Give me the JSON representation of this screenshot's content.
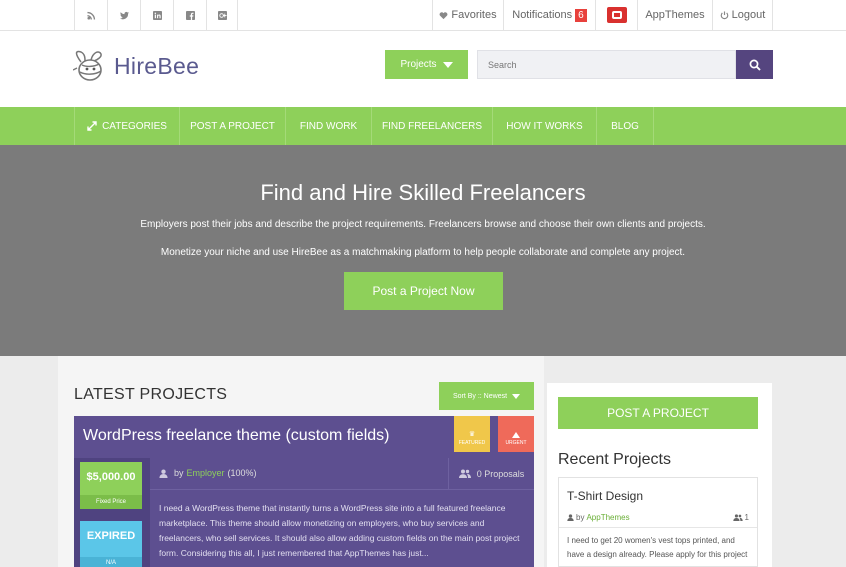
{
  "topbar": {
    "social_icons": [
      "rss-icon",
      "twitter-icon",
      "linkedin-icon",
      "facebook-icon",
      "google-plus-icon"
    ],
    "favorites_label": "Favorites",
    "notifications_label": "Notifications",
    "notifications_count": "6",
    "appthemes_label": "AppThemes",
    "logout_label": "Logout"
  },
  "header": {
    "logo_text": "HireBee",
    "projects_label": "Projects",
    "search_placeholder": "Search"
  },
  "nav": {
    "items": [
      "CATEGORIES",
      "POST A PROJECT",
      "FIND WORK",
      "FIND FREELANCERS",
      "HOW IT WORKS",
      "BLOG"
    ]
  },
  "hero": {
    "title": "Find and Hire Skilled Freelancers",
    "line1": "Employers post their jobs and describe the project requirements. Freelancers browse and choose their own clients and projects.",
    "line2": "Monetize your niche and use HireBee as a matchmaking platform to help people collaborate and complete any project.",
    "cta": "Post a Project Now"
  },
  "latest": {
    "title": "LATEST PROJECTS",
    "sort_label": "Sort By :: Newest",
    "project": {
      "title": "WordPress freelance theme (custom fields)",
      "featured_label": "FEATURED",
      "urgent_label": "URGENT",
      "price": "$5,000.00",
      "price_type": "Fixed Price",
      "status": "EXPIRED",
      "status_sub": "N/A",
      "by_prefix": "by",
      "author": "Employer",
      "rating": "(100%)",
      "proposals": "0 Proposals",
      "description": "I need a WordPress theme that instantly turns a WordPress site into a full featured freelance marketplace. This theme should allow monetizing on employers, who buy services and freelancers, who sell services. It should also allow adding custom fields on the main post project form. Considering this all, I just remembered that AppThemes has just..."
    }
  },
  "sidebar": {
    "post_button": "POST A PROJECT",
    "recent_title": "Recent Projects",
    "recent": {
      "title": "T-Shirt Design",
      "by_prefix": "by",
      "author": "AppThemes",
      "count": "1",
      "description": "I need to get 20 women's vest tops printed, and have a design already. Please apply for this project"
    }
  },
  "colors": {
    "accent_green": "#8ed05a",
    "purple": "#5d4f90",
    "badge_red": "#e8413c",
    "featured_ribbon": "#f0c74a",
    "urgent_ribbon": "#ef6a5a",
    "status_blue": "#5bc6e8"
  }
}
